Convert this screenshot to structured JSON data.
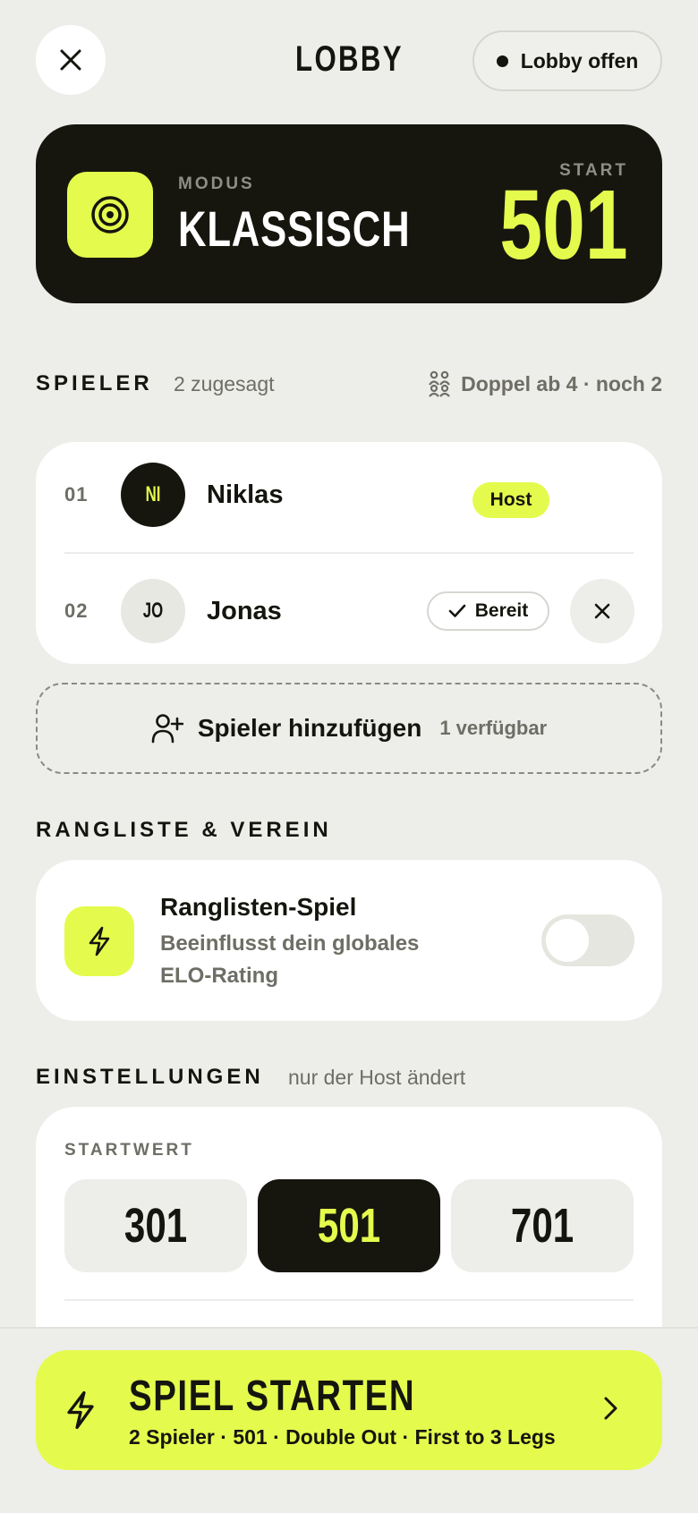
{
  "header": {
    "title": "LOBBY",
    "status": "Lobby offen"
  },
  "mode": {
    "label": "MODUS",
    "name": "KLASSISCH",
    "start_label": "START",
    "start_value": "501"
  },
  "players": {
    "heading": "SPIELER",
    "subtitle": "2 zugesagt",
    "meta": "Doppel ab 4 · noch 2",
    "items": [
      {
        "number": "01",
        "initials": "NI",
        "name": "Niklas",
        "badge": "Host"
      },
      {
        "number": "02",
        "initials": "JO",
        "name": "Jonas",
        "badge": "Bereit"
      }
    ],
    "add_label": "Spieler hinzufügen",
    "add_count": "1 verfügbar"
  },
  "ranking": {
    "heading": "RANGLISTE & VEREIN",
    "title": "Ranglisten-Spiel",
    "description": "Beeinflusst dein globales ELO-Rating",
    "enabled": false
  },
  "settings": {
    "heading": "EINSTELLUNGEN",
    "subtitle": "nur der Host ändert",
    "start_label": "STARTWERT",
    "options": [
      "301",
      "501",
      "701"
    ],
    "selected": "501"
  },
  "cta": {
    "title": "SPIEL STARTEN",
    "summary": "2 Spieler · 501 · Double Out · First to 3 Legs"
  },
  "colors": {
    "accent": "#e4fb4d",
    "dark": "#16160f",
    "background": "#ededea"
  }
}
